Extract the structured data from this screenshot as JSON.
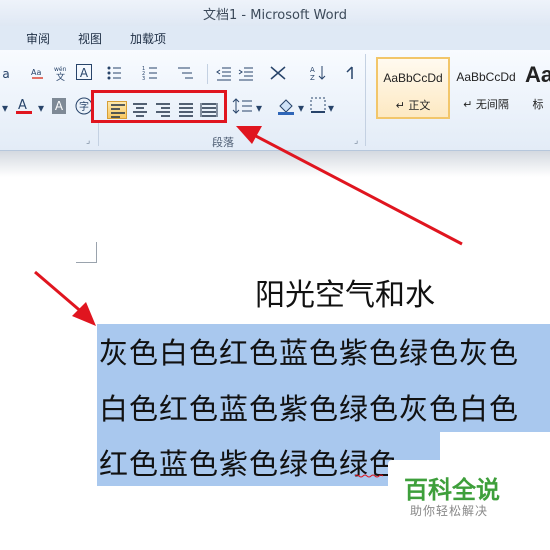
{
  "window": {
    "title": "文档1  -  Microsoft Word"
  },
  "tabs": [
    "审阅",
    "视图",
    "加载项"
  ],
  "ribbon": {
    "paragraph_group_label": "段落",
    "styles": [
      {
        "sample": "AaBbCcDd",
        "name": "↵ 正文",
        "selected": true
      },
      {
        "sample": "AaBbCcDd",
        "name": "↵ 无间隔",
        "selected": false
      },
      {
        "sample": "Aa",
        "name": "标",
        "selected": false
      }
    ],
    "icons": [
      "clear-format-icon",
      "phonetic-icon",
      "char-border-icon",
      "bullets-icon",
      "numbering-icon",
      "multilevel-list-icon",
      "decrease-indent-icon",
      "increase-indent-icon",
      "chinese-layout-icon",
      "sort-icon",
      "show-marks-icon",
      "font-color-icon",
      "char-shading-icon",
      "enclose-char-icon",
      "align-left-icon",
      "align-center-icon",
      "align-right-icon",
      "justify-icon",
      "distributed-icon",
      "line-spacing-icon",
      "shading-icon",
      "borders-icon"
    ]
  },
  "document": {
    "title": "阳光空气和水",
    "lines": [
      "灰色白色红色蓝色紫色绿色灰色",
      "白色红色蓝色紫色绿色灰色白色",
      "红色蓝色紫色绿色绿色"
    ]
  },
  "watermark": {
    "logo": "百科全说",
    "subtitle": "助你轻松解决"
  },
  "colors": {
    "highlight": "#a9c8ee",
    "annotation_red": "#e0151f",
    "active_button": "#f8c760"
  }
}
